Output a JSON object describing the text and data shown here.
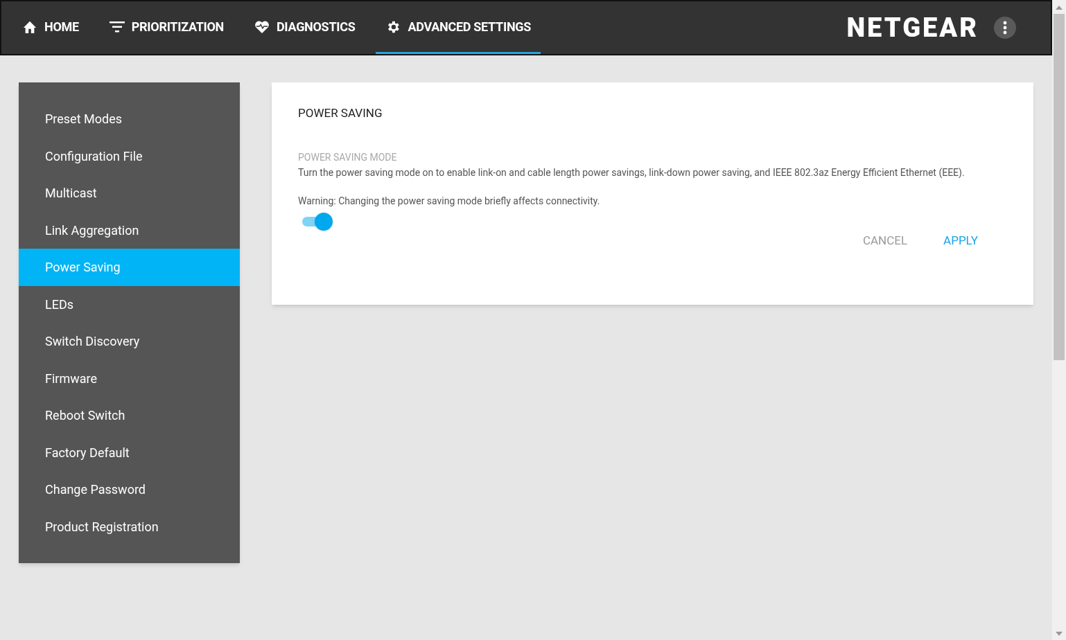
{
  "nav": {
    "tabs": [
      {
        "label": "HOME",
        "kind": "home",
        "selected": false
      },
      {
        "label": "PRIORITIZATION",
        "kind": "filter",
        "selected": false
      },
      {
        "label": "DIAGNOSTICS",
        "kind": "heart",
        "selected": false
      },
      {
        "label": "ADVANCED SETTINGS",
        "kind": "gear",
        "selected": true
      }
    ],
    "logo": "NETGEAR"
  },
  "sidebar": {
    "items": [
      {
        "label": "Preset Modes",
        "selected": false
      },
      {
        "label": "Configuration File",
        "selected": false
      },
      {
        "label": "Multicast",
        "selected": false
      },
      {
        "label": "Link Aggregation",
        "selected": false
      },
      {
        "label": "Power Saving",
        "selected": true
      },
      {
        "label": "LEDs",
        "selected": false
      },
      {
        "label": "Switch Discovery",
        "selected": false
      },
      {
        "label": "Firmware",
        "selected": false
      },
      {
        "label": "Reboot Switch",
        "selected": false
      },
      {
        "label": "Factory Default",
        "selected": false
      },
      {
        "label": "Change Password",
        "selected": false
      },
      {
        "label": "Product Registration",
        "selected": false
      }
    ]
  },
  "card": {
    "title": "POWER SAVING",
    "section_label": "POWER SAVING MODE",
    "description": "Turn the power saving mode on to enable link-on and cable length power savings, link-down power saving, and IEEE 802.3az Energy Efficient Ethernet (EEE).",
    "warning": "Warning: Changing the power saving mode briefly affects connectivity.",
    "toggle": {
      "on": true
    },
    "buttons": [
      {
        "label": "CANCEL",
        "kind": "secondary"
      },
      {
        "label": "APPLY",
        "kind": "primary"
      }
    ]
  }
}
